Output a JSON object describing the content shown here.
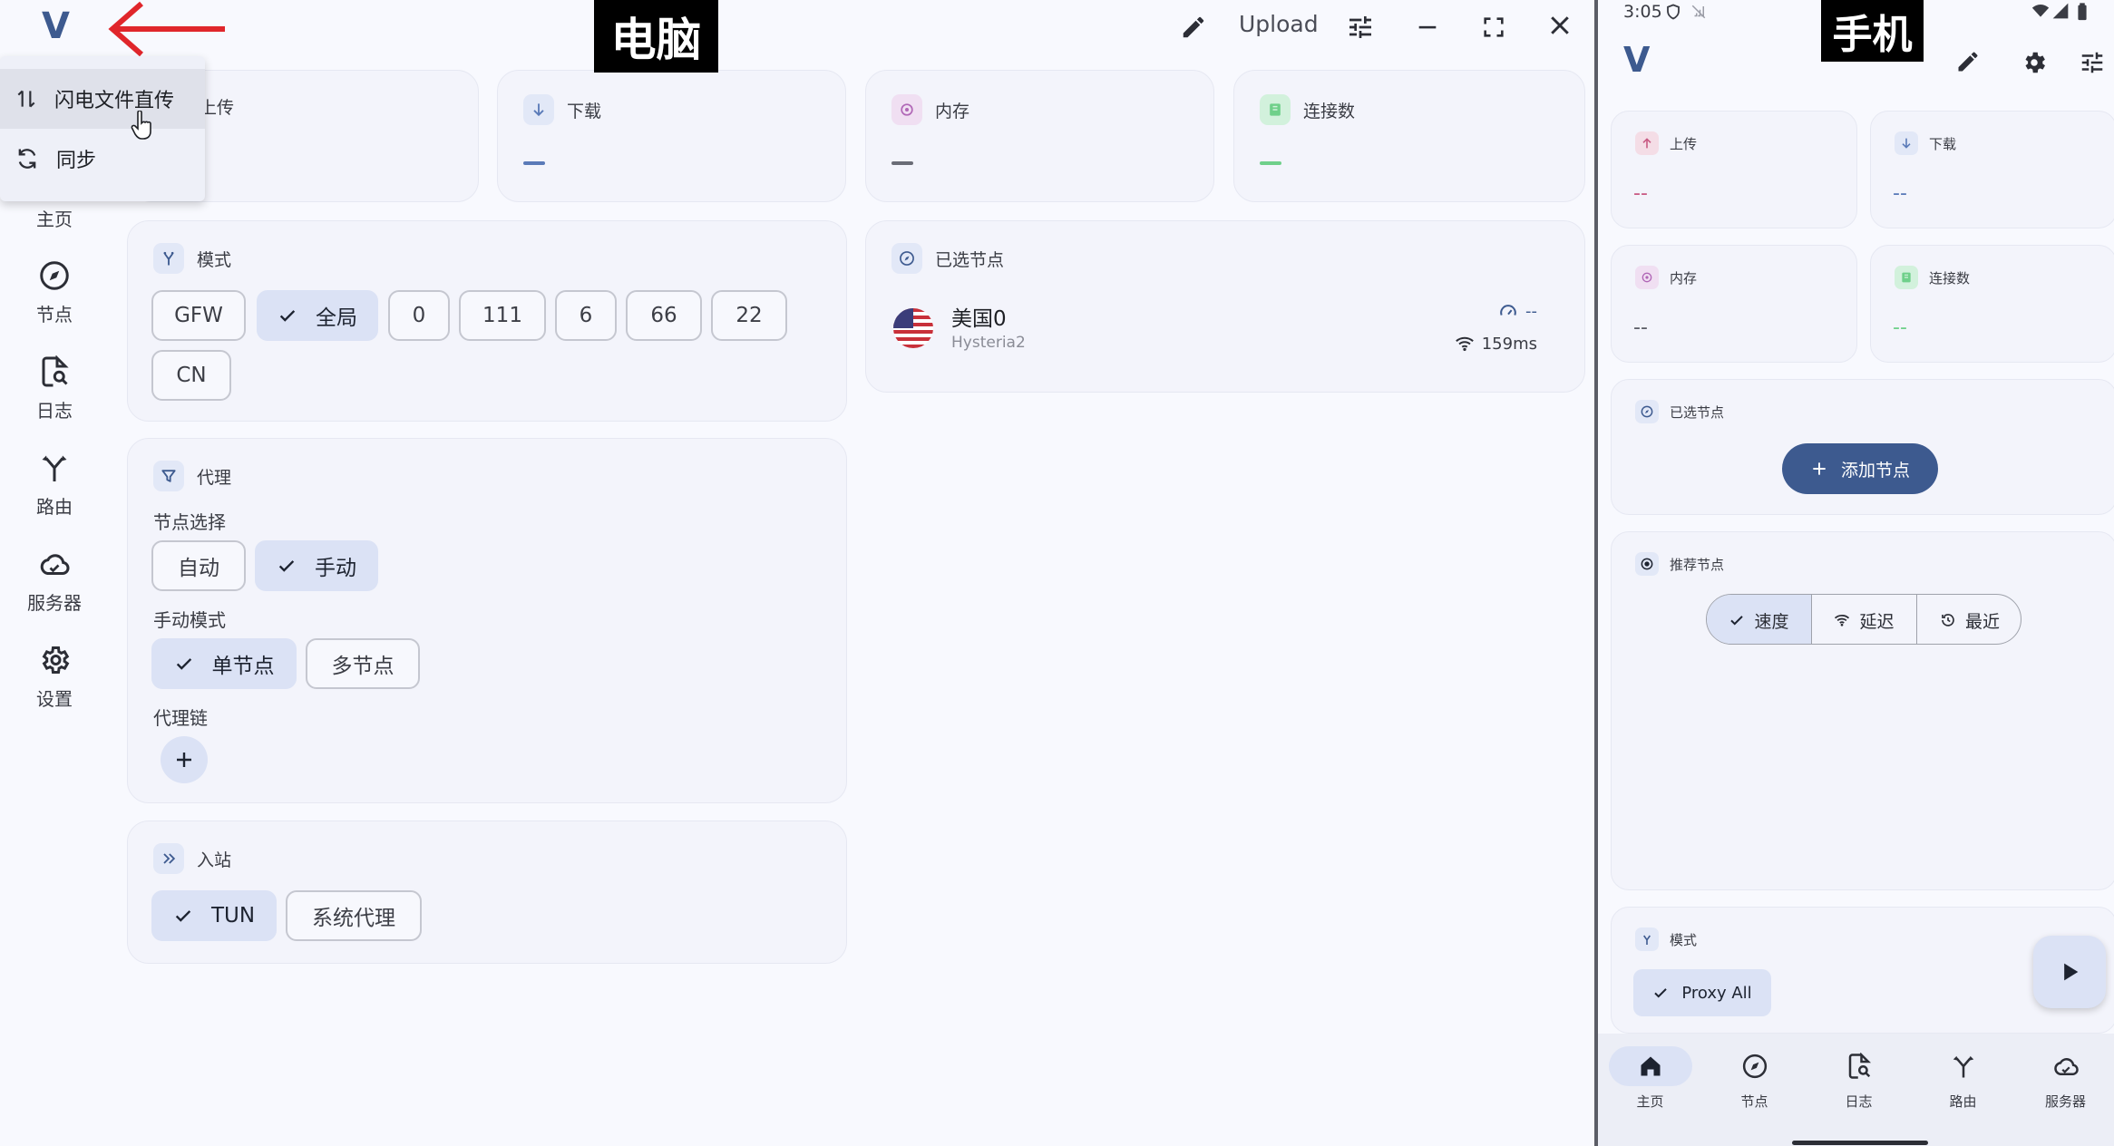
{
  "overlay_labels": {
    "desktop": "电脑",
    "phone": "手机"
  },
  "desktop": {
    "logo": "V",
    "toolbar": {
      "upload": "Upload"
    },
    "menu": {
      "items": [
        "闪电文件直传",
        "同步"
      ]
    },
    "nav": [
      {
        "label": "主页",
        "icon": "home-icon"
      },
      {
        "label": "节点",
        "icon": "compass-icon"
      },
      {
        "label": "日志",
        "icon": "log-search-icon"
      },
      {
        "label": "路由",
        "icon": "route-fork-icon"
      },
      {
        "label": "服务器",
        "icon": "cloud-icon"
      },
      {
        "label": "设置",
        "icon": "gear-icon"
      }
    ],
    "stats": {
      "upload": {
        "label": "上传",
        "value": ""
      },
      "download": {
        "label": "下载",
        "value": ""
      },
      "memory": {
        "label": "内存",
        "value": ""
      },
      "connections": {
        "label": "连接数",
        "value": ""
      }
    },
    "mode": {
      "title": "模式",
      "options": [
        "GFW",
        "全局",
        "0",
        "111",
        "6",
        "66",
        "22",
        "CN"
      ],
      "selected": "全局"
    },
    "proxy": {
      "title": "代理",
      "node_select_label": "节点选择",
      "node_select_options": [
        "自动",
        "手动"
      ],
      "node_select_selected": "手动",
      "manual_mode_label": "手动模式",
      "manual_mode_options": [
        "单节点",
        "多节点"
      ],
      "manual_mode_selected": "单节点",
      "chain_label": "代理链"
    },
    "inbound": {
      "title": "入站",
      "options": [
        "TUN",
        "系统代理"
      ],
      "selected": "TUN"
    },
    "selected_node": {
      "title": "已选节点",
      "name": "美国0",
      "protocol": "Hysteria2",
      "speed": "--",
      "latency": "159ms"
    }
  },
  "phone": {
    "status_bar": {
      "time": "3:05"
    },
    "logo": "V",
    "stats": {
      "upload": {
        "label": "上传",
        "value": "--"
      },
      "download": {
        "label": "下载",
        "value": "--"
      },
      "memory": {
        "label": "内存",
        "value": "--"
      },
      "connections": {
        "label": "连接数",
        "value": "--"
      }
    },
    "selected_node": {
      "title": "已选节点",
      "add_button": "添加节点"
    },
    "recommended": {
      "title": "推荐节点",
      "tabs": [
        "速度",
        "延迟",
        "最近"
      ],
      "selected": "速度"
    },
    "mode": {
      "title": "模式",
      "option": "Proxy All"
    },
    "nav": [
      {
        "label": "主页",
        "icon": "home-icon"
      },
      {
        "label": "节点",
        "icon": "compass-icon"
      },
      {
        "label": "日志",
        "icon": "log-search-icon"
      },
      {
        "label": "路由",
        "icon": "route-fork-icon"
      },
      {
        "label": "服务器",
        "icon": "cloud-icon"
      }
    ],
    "nav_selected": "主页"
  },
  "colors": {
    "accent": "#3d5a8f",
    "selected_chip": "#dbe2f5",
    "card_bg": "#f3f4fb",
    "upload": "#c85a83",
    "download": "#5a7ab8",
    "memory": "#6a6c76",
    "connections": "#6fd08a",
    "arrow": "#e0262b"
  }
}
